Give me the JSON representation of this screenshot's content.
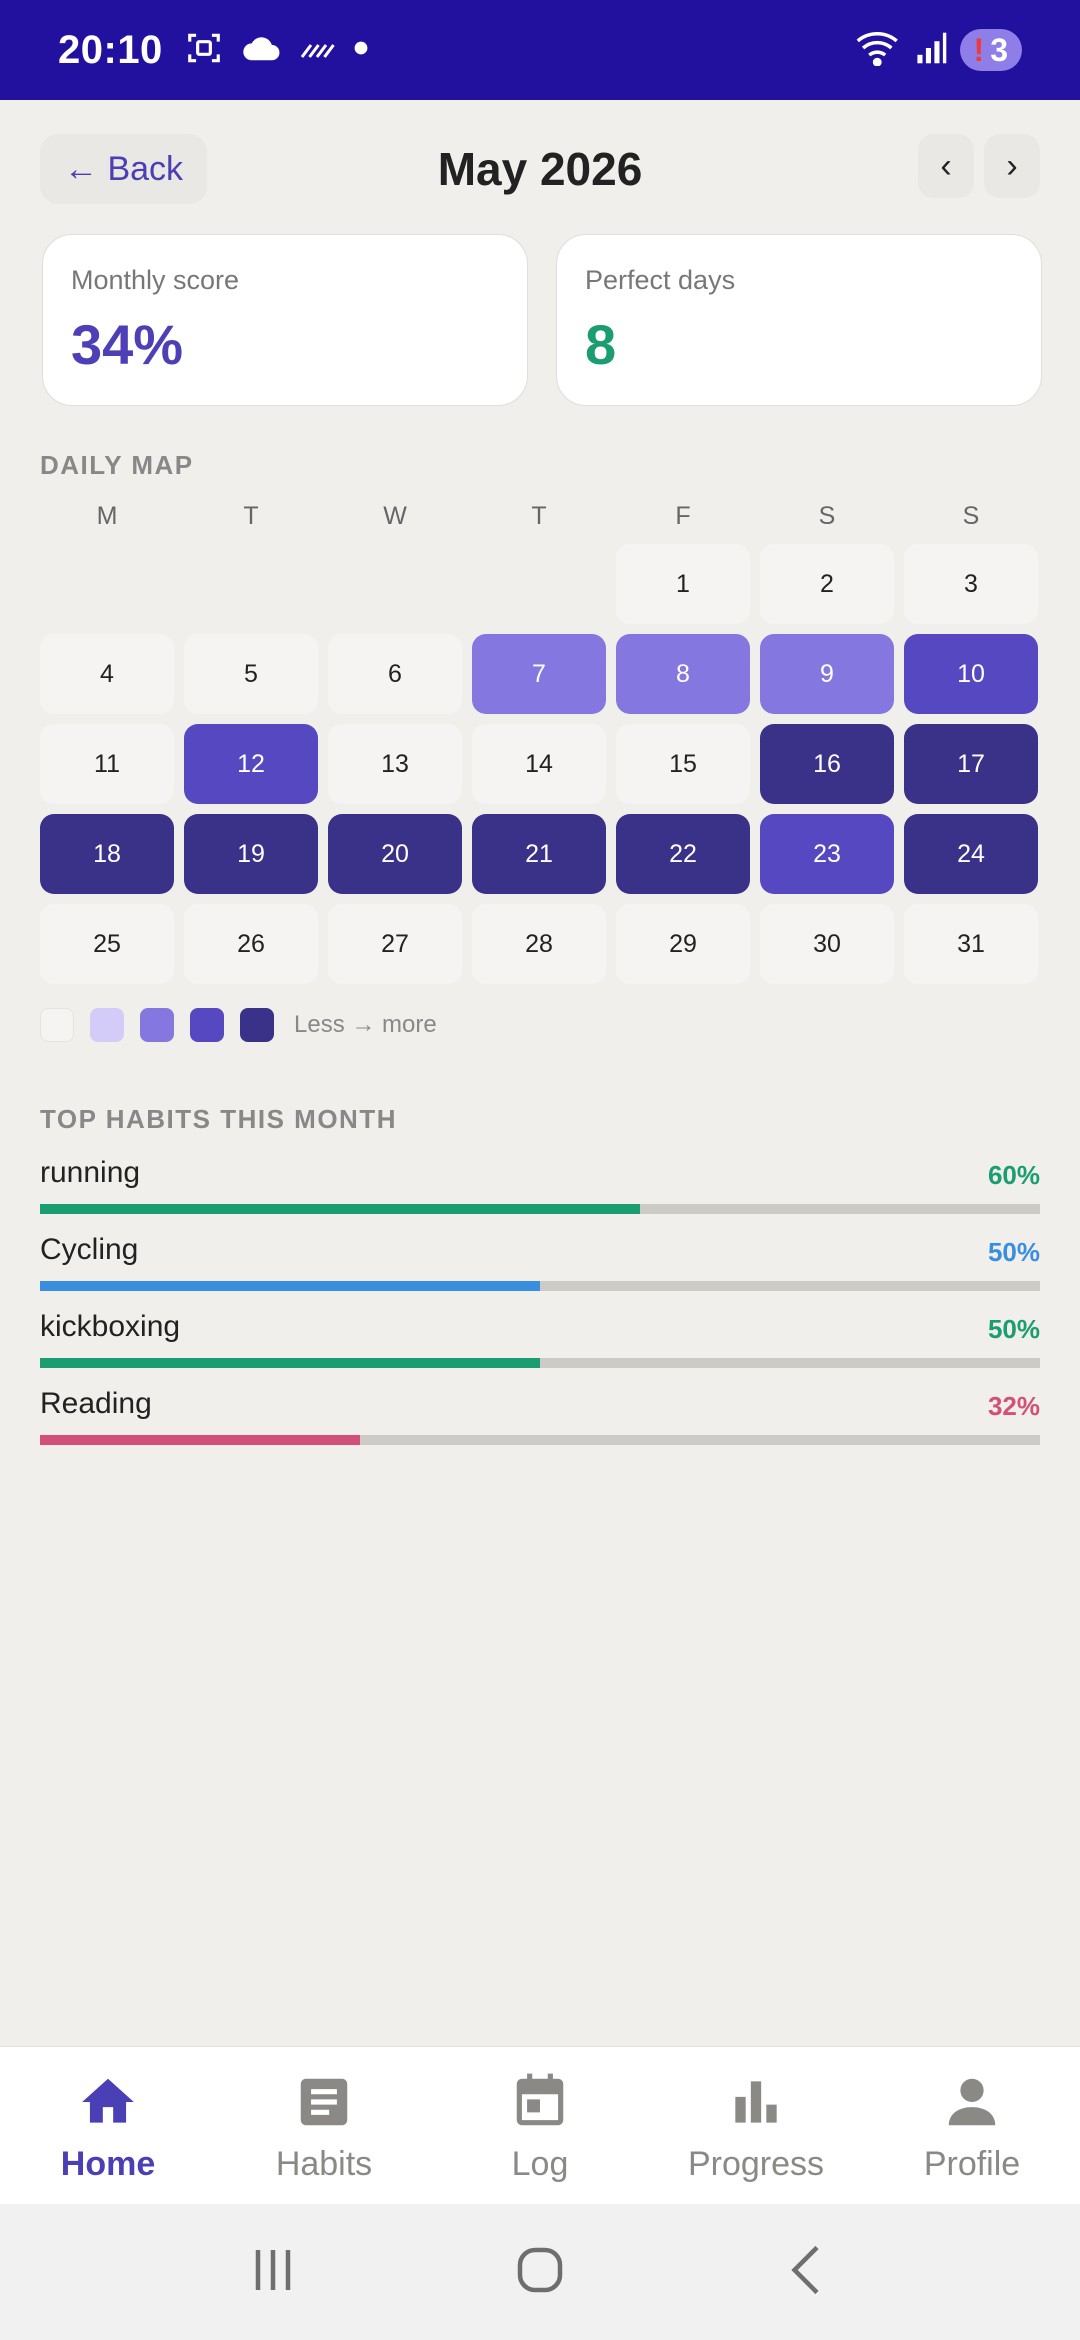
{
  "status_bar": {
    "time": "20:10",
    "notification_count": "3",
    "icons": [
      "screenshot-icon",
      "cloud-icon",
      "haze-icon",
      "dot-icon",
      "wifi-icon",
      "signal-icon",
      "alert-icon"
    ]
  },
  "header": {
    "back_label": "← Back",
    "title": "May 2026",
    "prev_label": "‹",
    "next_label": "›"
  },
  "stats": {
    "monthly_score": {
      "label": "Monthly score",
      "value": "34%",
      "color": "#4D40B7"
    },
    "perfect_days": {
      "label": "Perfect days",
      "value": "8",
      "color": "#1B9D72"
    }
  },
  "daily_map": {
    "title": "DAILY MAP",
    "weekdays": [
      "M",
      "T",
      "W",
      "T",
      "F",
      "S",
      "S"
    ],
    "leading_blank_days": 4,
    "days": [
      {
        "day": "1",
        "level": 0
      },
      {
        "day": "2",
        "level": 0
      },
      {
        "day": "3",
        "level": 0
      },
      {
        "day": "4",
        "level": 0
      },
      {
        "day": "5",
        "level": 0
      },
      {
        "day": "6",
        "level": 0
      },
      {
        "day": "7",
        "level": 2
      },
      {
        "day": "8",
        "level": 2
      },
      {
        "day": "9",
        "level": 2
      },
      {
        "day": "10",
        "level": 3
      },
      {
        "day": "11",
        "level": 0
      },
      {
        "day": "12",
        "level": 3
      },
      {
        "day": "13",
        "level": 0
      },
      {
        "day": "14",
        "level": 0
      },
      {
        "day": "15",
        "level": 0
      },
      {
        "day": "16",
        "level": 4
      },
      {
        "day": "17",
        "level": 4
      },
      {
        "day": "18",
        "level": 4
      },
      {
        "day": "19",
        "level": 4
      },
      {
        "day": "20",
        "level": 4
      },
      {
        "day": "21",
        "level": 4
      },
      {
        "day": "22",
        "level": 4
      },
      {
        "day": "23",
        "level": 3
      },
      {
        "day": "24",
        "level": 4
      },
      {
        "day": "25",
        "level": 0
      },
      {
        "day": "26",
        "level": 0
      },
      {
        "day": "27",
        "level": 0
      },
      {
        "day": "28",
        "level": 0
      },
      {
        "day": "29",
        "level": 0
      },
      {
        "day": "30",
        "level": 0
      },
      {
        "day": "31",
        "level": 0
      }
    ],
    "legend_colors": [
      "#F5F4F2",
      "#D3CCF8",
      "#8478E0",
      "#5548C0",
      "#3A3188"
    ],
    "legend_label": "Less → more"
  },
  "top_habits": {
    "title": "TOP HABITS THIS MONTH",
    "items": [
      {
        "name": "running",
        "percent_label": "60%",
        "percent": 60,
        "color": "#1B9D72"
      },
      {
        "name": "Cycling",
        "percent_label": "50%",
        "percent": 50,
        "color": "#3A8EE0"
      },
      {
        "name": "kickboxing",
        "percent_label": "50%",
        "percent": 50,
        "color": "#1B9D72"
      },
      {
        "name": "Reading",
        "percent_label": "32%",
        "percent": 32,
        "color": "#D2507A"
      }
    ]
  },
  "bottom_nav": {
    "items": [
      {
        "label": "Home",
        "icon": "home-icon",
        "active": true
      },
      {
        "label": "Habits",
        "icon": "habits-icon",
        "active": false
      },
      {
        "label": "Log",
        "icon": "calendar-icon",
        "active": false
      },
      {
        "label": "Progress",
        "icon": "bar-chart-icon",
        "active": false
      },
      {
        "label": "Profile",
        "icon": "person-icon",
        "active": false
      }
    ]
  },
  "colors": {
    "status_bar": "#22119E",
    "accent": "#4A3FB4",
    "background": "#F0EFEB"
  }
}
